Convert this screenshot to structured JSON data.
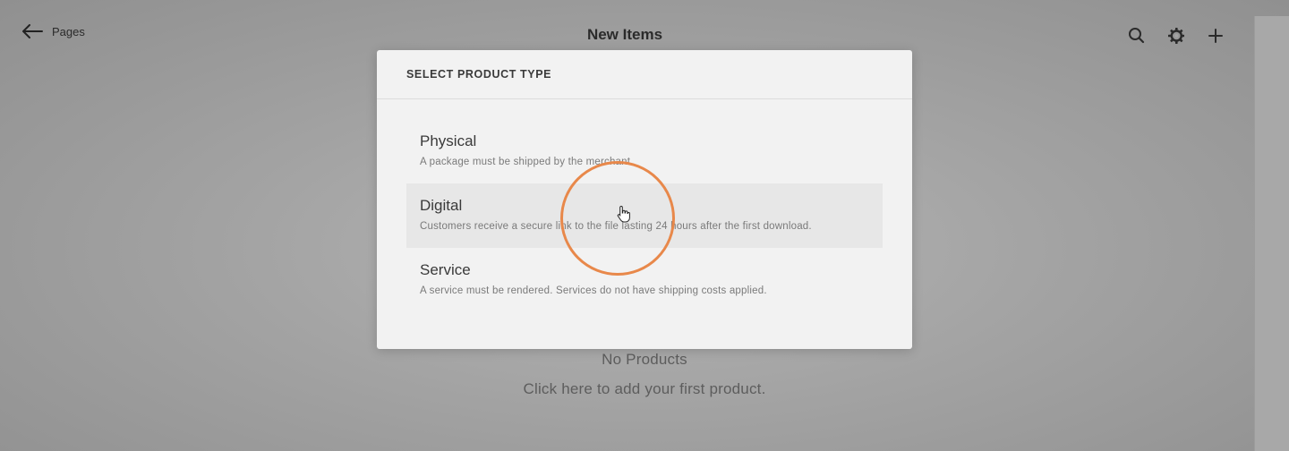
{
  "topbar": {
    "back_label": "Pages",
    "title": "New Items",
    "icons": [
      "search-icon",
      "gear-icon",
      "plus-icon"
    ]
  },
  "empty_state": {
    "title": "No Products",
    "cta": "Click here to add your first product."
  },
  "modal": {
    "header": "SELECT PRODUCT TYPE",
    "options": [
      {
        "name": "Physical",
        "description": "A package must be shipped by the merchant."
      },
      {
        "name": "Digital",
        "description": "Customers receive a secure link to the file lasting 24 hours after the first download."
      },
      {
        "name": "Service",
        "description": "A service must be rendered. Services do not have shipping costs applied."
      }
    ],
    "hovered_option": "Digital"
  },
  "colors": {
    "click_indicator": "#e8884a",
    "modal_background": "#f2f2f2",
    "overlay": "#a3a3a3"
  }
}
